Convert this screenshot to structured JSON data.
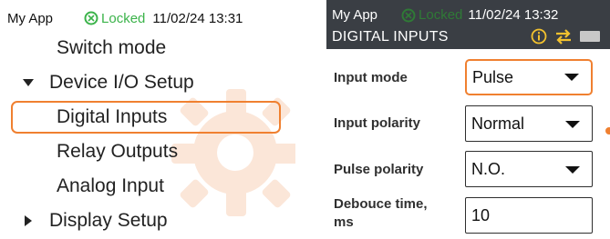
{
  "left_screen": {
    "status": {
      "app_name": "My App",
      "lock_text": "Locked",
      "datetime": "11/02/24 13:31"
    },
    "menu": {
      "switch_mode": "Switch mode",
      "device_io_setup": "Device I/O Setup",
      "digital_inputs": "Digital Inputs",
      "relay_outputs": "Relay Outputs",
      "analog_input": "Analog Input",
      "display_setup": "Display Setup"
    }
  },
  "right_screen": {
    "status": {
      "app_name": "My App",
      "lock_text": "Locked",
      "datetime": "11/02/24 13:32"
    },
    "title": "DIGITAL INPUTS",
    "form": {
      "input_mode": {
        "label": "Input mode",
        "value": "Pulse"
      },
      "input_polarity": {
        "label": "Input polarity",
        "value": "Normal"
      },
      "pulse_polarity": {
        "label": "Pulse polarity",
        "value": "N.O."
      },
      "debounce_time": {
        "label_line1": "Debouce time,",
        "label_line2": "ms",
        "value": "10"
      }
    }
  },
  "colors": {
    "accent": "#f08030",
    "lock_green_left": "#3bb34a",
    "lock_green_right": "#2f7a36",
    "header_bg": "#3a3e44",
    "info_icon": "#f2c12e"
  },
  "icons": [
    "lock-icon",
    "expanded-arrow-icon",
    "collapsed-arrow-icon",
    "info-icon",
    "swap-arrows-icon",
    "battery-icon",
    "dropdown-caret-icon"
  ]
}
